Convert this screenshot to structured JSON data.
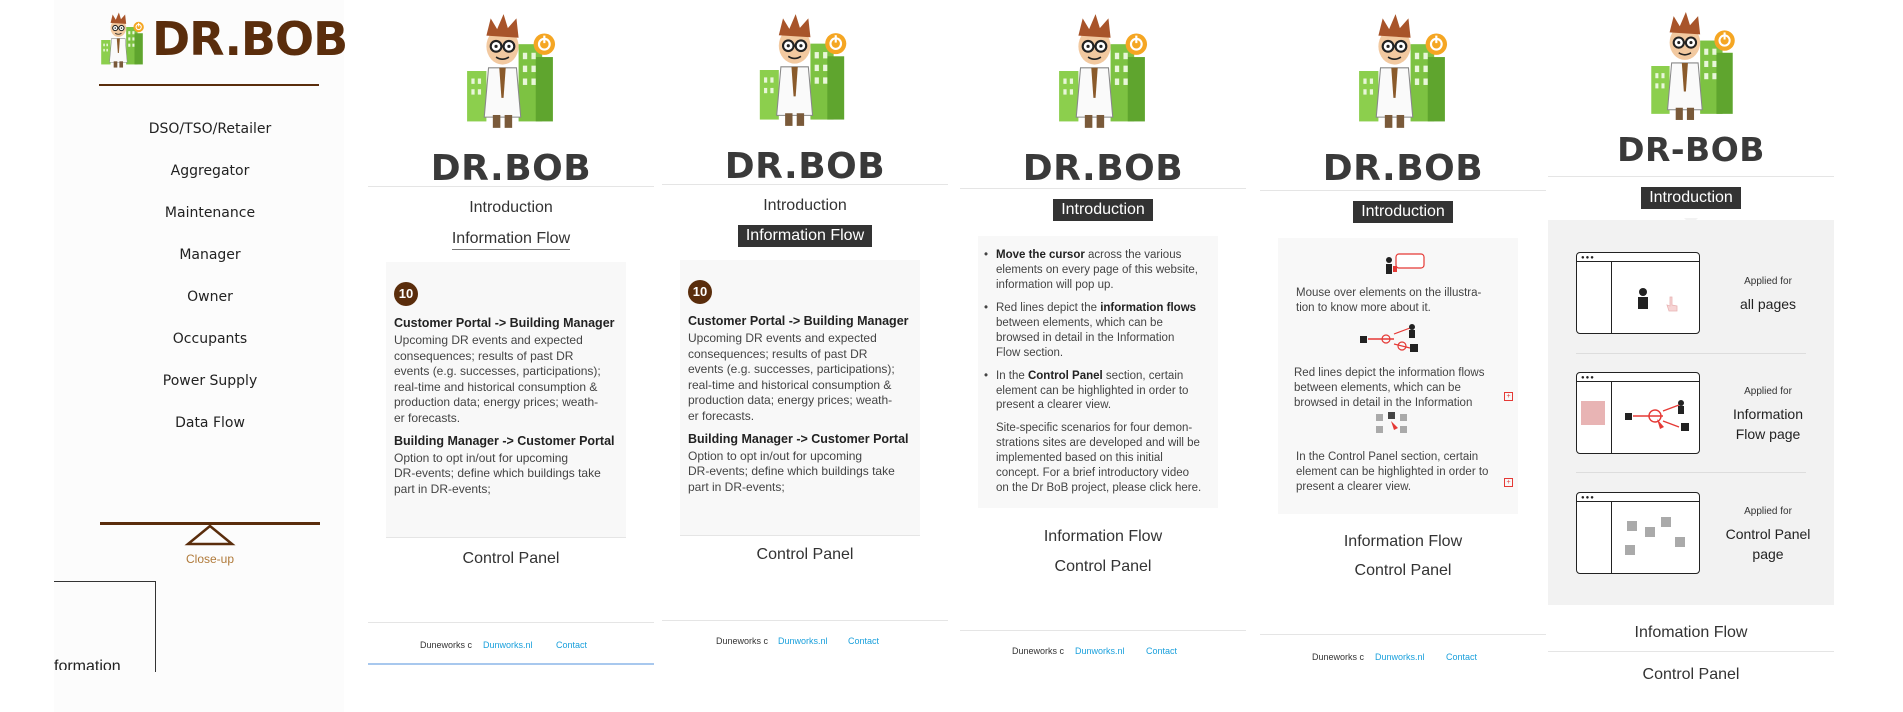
{
  "brand": {
    "name_dot": "DR.BOB",
    "name_dash": "DR-BOB"
  },
  "sidebar": {
    "items": [
      {
        "label": "DSO/TSO/Retailer"
      },
      {
        "label": "Aggregator"
      },
      {
        "label": "Maintenance"
      },
      {
        "label": "Manager"
      },
      {
        "label": "Owner"
      },
      {
        "label": "Occupants"
      },
      {
        "label": "Power Supply"
      },
      {
        "label": "Data Flow"
      }
    ],
    "closeup_label": "Close-up",
    "cropped_text": "formation"
  },
  "nav": {
    "introduction": "Introduction",
    "information_flow": "Information Flow",
    "control_panel": "Control Panel",
    "infomation_flow_typo": "Infomation Flow"
  },
  "flow_panel": {
    "badge": "10",
    "heading1": "Customer Portal -> Building Manager",
    "body1a": "Upcoming DR events and expected",
    "body1b": "consequences; results of past DR",
    "body1c": "events (e.g. successes, participations);",
    "body1d": "real-time and historical consumption &",
    "body1e": "production data; energy prices; weath-",
    "body1f": "er forecasts.",
    "heading2": "Building Manager -> Customer Portal",
    "body2a": "Option to opt in/out for upcoming",
    "body2b": "DR-events; define which buildings take",
    "body2c": "part in DR-events;"
  },
  "intro_panel": {
    "b1_bold": "Move the cursor",
    "b1a": " across the various",
    "b1b": "elements on every page of this website,",
    "b1c": "information will pop up.",
    "b2a": "Red lines depict the ",
    "b2_bold": "information flows",
    "b2b": "between elements, which can be",
    "b2c": "browsed in detail in the Information",
    "b2d": "Flow section.",
    "b3a": "In the ",
    "b3_bold": "Control Panel",
    "b3b": " section, certain",
    "b3c": "element can be highlighted in order to",
    "b3d": "present a clearer view.",
    "p4a": "Site-specific scenarios for four demon-",
    "p4b": "strations sites are developed and will be",
    "p4c": "implemented based on this initial",
    "p4d": "concept. For a brief introductory video",
    "p4e": "on the Dr BoB project, please click here."
  },
  "icon_panel": {
    "t1a": "Mouse over elements on the illustra-",
    "t1b": "tion to know more about it.",
    "t2a": "Red lines depict the information flows",
    "t2b": "between elements, which can be",
    "t2c": "browsed in detail in the Information",
    "t3a": "In the Control Panel section, certain",
    "t3b": "element can be highlighted in order to",
    "t3c": "present a clearer view."
  },
  "applied": {
    "label": "Applied for",
    "r1": "all pages",
    "r2a": "Information",
    "r2b": "Flow page",
    "r3a": "Control Panel",
    "r3b": "page"
  },
  "footer": {
    "company": "Duneworks c",
    "site": "Dunworks.nl",
    "contact": "Contact"
  },
  "colors": {
    "brand_brown": "#5a2d0c",
    "link_blue": "#1aa0dc",
    "highlight_dark": "#333333",
    "accent_red": "#e53935",
    "building_green": "#7dc242"
  }
}
